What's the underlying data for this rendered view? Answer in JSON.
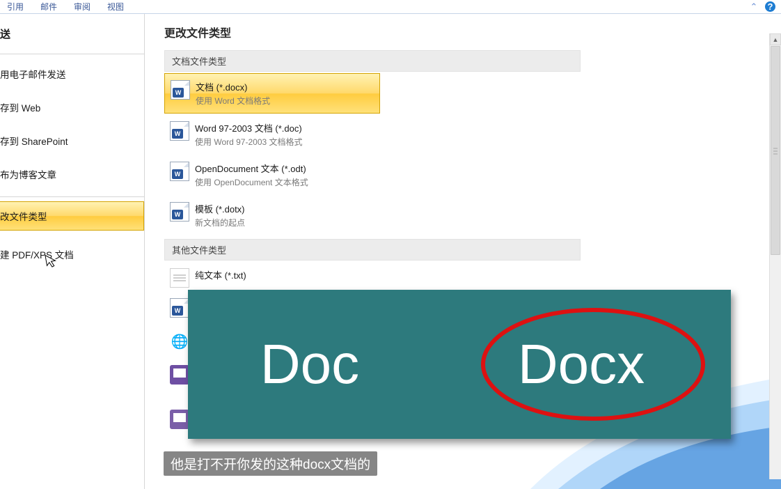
{
  "ribbon": {
    "tabs": [
      "引用",
      "邮件",
      "审阅",
      "视图"
    ]
  },
  "sidebar": {
    "top_heading": "送",
    "items": [
      "用电子邮件发送",
      "存到 Web",
      "存到 SharePoint",
      "布为博客文章"
    ],
    "selected": "改文件类型",
    "after": "建 PDF/XPS 文档"
  },
  "main": {
    "title": "更改文件类型",
    "sections": [
      {
        "header": "文档文件类型",
        "items": [
          {
            "title": "文档 (*.docx)",
            "desc": "使用 Word 文档格式",
            "icon": "word",
            "selected": true
          },
          {
            "title": "Word 97-2003 文档 (*.doc)",
            "desc": "使用 Word 97-2003 文档格式",
            "icon": "word",
            "selected": false
          },
          {
            "title": "OpenDocument 文本 (*.odt)",
            "desc": "使用 OpenDocument 文本格式",
            "icon": "word",
            "selected": false
          },
          {
            "title": "模板 (*.dotx)",
            "desc": "新文档的起点",
            "icon": "word",
            "selected": false
          }
        ]
      },
      {
        "header": "其他文件类型",
        "items": [
          {
            "title": "纯文本 (*.txt)",
            "desc": "",
            "icon": "txt",
            "selected": false
          }
        ]
      }
    ],
    "obscured_icons": [
      "word",
      "globe",
      "save",
      "save"
    ]
  },
  "overlay": {
    "left_text": "Doc",
    "right_text": "Docx"
  },
  "subtitle": "他是打不开你发的这种docx文档的"
}
